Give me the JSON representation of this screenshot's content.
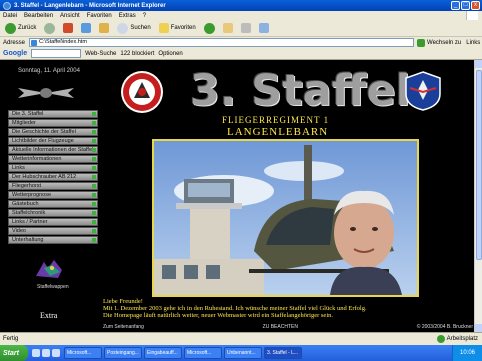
{
  "window": {
    "title": "3. Staffel - Langenlebarn - Microsoft Internet Explorer",
    "buttons": {
      "minimize": "_",
      "maximize": "□",
      "close": "x"
    }
  },
  "menubar": {
    "items": [
      "Datei",
      "Bearbeiten",
      "Ansicht",
      "Favoriten",
      "Extras",
      "?"
    ]
  },
  "toolbar": {
    "back_label": "Zurück",
    "search_label": "Suchen",
    "favorites_label": "Favoriten"
  },
  "addressbar": {
    "label": "Adresse",
    "url": "C:\\Staffel\\index.htm",
    "go_label": "Wechseln zu",
    "links_label": "Links"
  },
  "googlebar": {
    "logo": "Google",
    "search_web_label": "Web-Suche",
    "blocked_label": "122 blockiert",
    "options_label": "Optionen"
  },
  "page": {
    "date": "Sonntag, 11. April 2004",
    "nav_items": [
      "Die 3. Staffel",
      "Mitglieder",
      "Die Geschichte der Staffel",
      "Lichtbilder der Flugzeuge",
      "Aktuelle Informationen der Staffel",
      "Wetterinformationen",
      "Links",
      "Der Hubschrauber AB 212",
      "Fliegerhorst",
      "Wetterprognose",
      "Gästebuch",
      "Staffelchronik",
      "Links / Partner",
      "Video",
      "Unterhaltung"
    ],
    "wolf_caption": "Staffelwappen",
    "extra_label": "Extra",
    "heading": "3. Staffel",
    "subtitle_1": "FLIEGERREGIMENT 1",
    "subtitle_2": "LANGENLEBARN",
    "welcome_lines": [
      "Liebe Freunde!",
      "Mit 1. Dezember 2003 gehe ich in den Ruhestand. Ich wünsche meiner Staffel viel Glück und Erfolg.",
      "Die Homepage läuft natürlich weiter, neuer Webmaster wird ein Staffelangehöriger sein."
    ],
    "footer_left": "Zum Seitenanfang",
    "footer_center": "ZU BEACHTEN",
    "footer_right": "© 2003/2004 B. Bruckner"
  },
  "statusbar": {
    "text": "Fertig",
    "zone": "Arbeitsplatz"
  },
  "taskbar": {
    "start_label": "Start",
    "tasks": [
      "Microsoft...",
      "Posteingang...",
      "Eingabeauff...",
      "Microsoft...",
      "Unbenannt...",
      "3. Staffel - L..."
    ],
    "clock": "10:06"
  },
  "colors": {
    "accent_yellow": "#ffe84b",
    "page_bg": "#000000",
    "xp_blue": "#0a5fd8"
  }
}
